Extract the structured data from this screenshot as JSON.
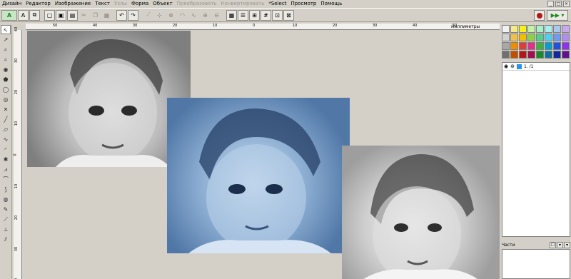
{
  "menu": {
    "items": [
      {
        "label": "Дизайн",
        "disabled": false
      },
      {
        "label": "Редактор",
        "disabled": false
      },
      {
        "label": "Изображение",
        "disabled": false
      },
      {
        "label": "Текст",
        "disabled": false
      },
      {
        "label": "Узлы",
        "disabled": true
      },
      {
        "label": "Форма",
        "disabled": false
      },
      {
        "label": "Объект",
        "disabled": false
      },
      {
        "label": "Преобразовать",
        "disabled": true
      },
      {
        "label": "Конвертировать",
        "disabled": true
      },
      {
        "label": "*Select",
        "disabled": false
      },
      {
        "label": "Просмотр",
        "disabled": false
      },
      {
        "label": "Помощь",
        "disabled": false
      }
    ],
    "window_buttons": [
      "_",
      "□",
      "×"
    ]
  },
  "toolbar": {
    "logo": "A",
    "tools": [
      {
        "name": "text-tool-icon",
        "glyph": "A",
        "grey": false
      },
      {
        "name": "text-frame-icon",
        "glyph": "⧉",
        "grey": false
      },
      {
        "name": "new-file-icon",
        "glyph": "▢",
        "grey": false
      },
      {
        "name": "open-file-icon",
        "glyph": "▣",
        "grey": false
      },
      {
        "name": "save-icon",
        "glyph": "▤",
        "grey": false
      },
      {
        "name": "cut-icon",
        "glyph": "✂",
        "grey": true
      },
      {
        "name": "copy-icon",
        "glyph": "❐",
        "grey": true
      },
      {
        "name": "paste-icon",
        "glyph": "▦",
        "grey": true
      },
      {
        "name": "undo-icon",
        "glyph": "↶",
        "grey": false
      },
      {
        "name": "redo-icon",
        "glyph": "↷",
        "grey": false
      },
      {
        "name": "node-edit-icon",
        "glyph": "⟋",
        "grey": true
      },
      {
        "name": "node-add-icon",
        "glyph": "⊹",
        "grey": true
      },
      {
        "name": "node-delete-icon",
        "glyph": "⊗",
        "grey": true
      },
      {
        "name": "arc-icon",
        "glyph": "◠",
        "grey": true
      },
      {
        "name": "curve-icon",
        "glyph": "∿",
        "grey": true
      },
      {
        "name": "weld-icon",
        "glyph": "⊕",
        "grey": true
      },
      {
        "name": "trim-icon",
        "glyph": "⊖",
        "grey": true
      },
      {
        "name": "properties-icon",
        "glyph": "▦",
        "grey": false
      },
      {
        "name": "layers-icon",
        "glyph": "☰",
        "grey": false
      },
      {
        "name": "align-icon",
        "glyph": "⊞",
        "grey": false
      },
      {
        "name": "grid-icon",
        "glyph": "#",
        "grey": false
      },
      {
        "name": "zoom-fit-icon",
        "glyph": "⊡",
        "grey": false
      },
      {
        "name": "zoom-icon",
        "glyph": "⊠",
        "grey": false
      }
    ]
  },
  "toolbox": [
    {
      "name": "select-tool-icon",
      "glyph": "↖",
      "active": true
    },
    {
      "name": "node-tool-icon",
      "glyph": "↗",
      "active": false
    },
    {
      "name": "zoom-tool-icon",
      "glyph": "⌕",
      "active": false
    },
    {
      "name": "zoom-out-tool-icon",
      "glyph": "⌕",
      "active": false
    },
    {
      "name": "fill-tool-icon",
      "glyph": "◉",
      "active": false
    },
    {
      "name": "polygon-tool-icon",
      "glyph": "⬟",
      "active": false
    },
    {
      "name": "ellipse-tool-icon",
      "glyph": "◯",
      "active": false
    },
    {
      "name": "spiral-tool-icon",
      "glyph": "◎",
      "active": false
    },
    {
      "name": "cross-tool-icon",
      "glyph": "✕",
      "active": false
    },
    {
      "name": "line-tool-icon",
      "glyph": "╱",
      "active": false
    },
    {
      "name": "rect-tool-icon",
      "glyph": "▱",
      "active": false
    },
    {
      "name": "freehand-tool-icon",
      "glyph": "∿",
      "active": false
    },
    {
      "name": "arc-tool-icon",
      "glyph": "◜",
      "active": false
    },
    {
      "name": "star-tool-icon",
      "glyph": "✱",
      "active": false
    },
    {
      "name": "zigzag-tool-icon",
      "glyph": "⩘",
      "active": false
    },
    {
      "name": "curve-tool-icon",
      "glyph": "⌒",
      "active": false
    },
    {
      "name": "bezier-tool-icon",
      "glyph": "⟆",
      "active": false
    },
    {
      "name": "circle-tool-icon",
      "glyph": "◍",
      "active": false
    },
    {
      "name": "pen-tool-icon",
      "glyph": "✎",
      "active": false
    },
    {
      "name": "knife-tool-icon",
      "glyph": "⟋",
      "active": false
    },
    {
      "name": "measure-tool-icon",
      "glyph": "⟂",
      "active": false
    },
    {
      "name": "brush-tool-icon",
      "glyph": "⫽",
      "active": false
    }
  ],
  "rulers": {
    "units_label": "миллиметры",
    "top_ticks": [
      "50",
      "40",
      "30",
      "20",
      "10",
      "0",
      "10",
      "20",
      "30",
      "40",
      "50"
    ],
    "left_ticks": [
      "40",
      "30",
      "20",
      "10",
      "0",
      "10",
      "20",
      "30",
      "40"
    ]
  },
  "colors": {
    "palette": [
      "#f2f2f2",
      "#f4e88c",
      "#f6f01c",
      "#c8f0a8",
      "#a8f0c8",
      "#a8f0f0",
      "#a8c8f0",
      "#c8a8f0",
      "#d2d2d2",
      "#f0c050",
      "#f0c000",
      "#8cd04c",
      "#50d08c",
      "#50d0f0",
      "#6c9cf0",
      "#b48cf0",
      "#a8a8a8",
      "#f08c00",
      "#e03c3c",
      "#e0308c",
      "#3cb43c",
      "#00a0d0",
      "#2050e0",
      "#9030f0",
      "#707070",
      "#c05000",
      "#b01818",
      "#a01050",
      "#188c28",
      "#1070a0",
      "#1028a0",
      "#601090"
    ]
  },
  "layers": {
    "rows": [
      {
        "visible_glyph": "👁",
        "name": "1.  /1"
      }
    ]
  },
  "parts": {
    "label": "Части",
    "buttons": [
      "☐",
      "▾",
      "▾"
    ]
  },
  "photos": [
    {
      "name": "photo-grayscale"
    },
    {
      "name": "photo-blue-tint"
    },
    {
      "name": "photo-halftone"
    }
  ]
}
